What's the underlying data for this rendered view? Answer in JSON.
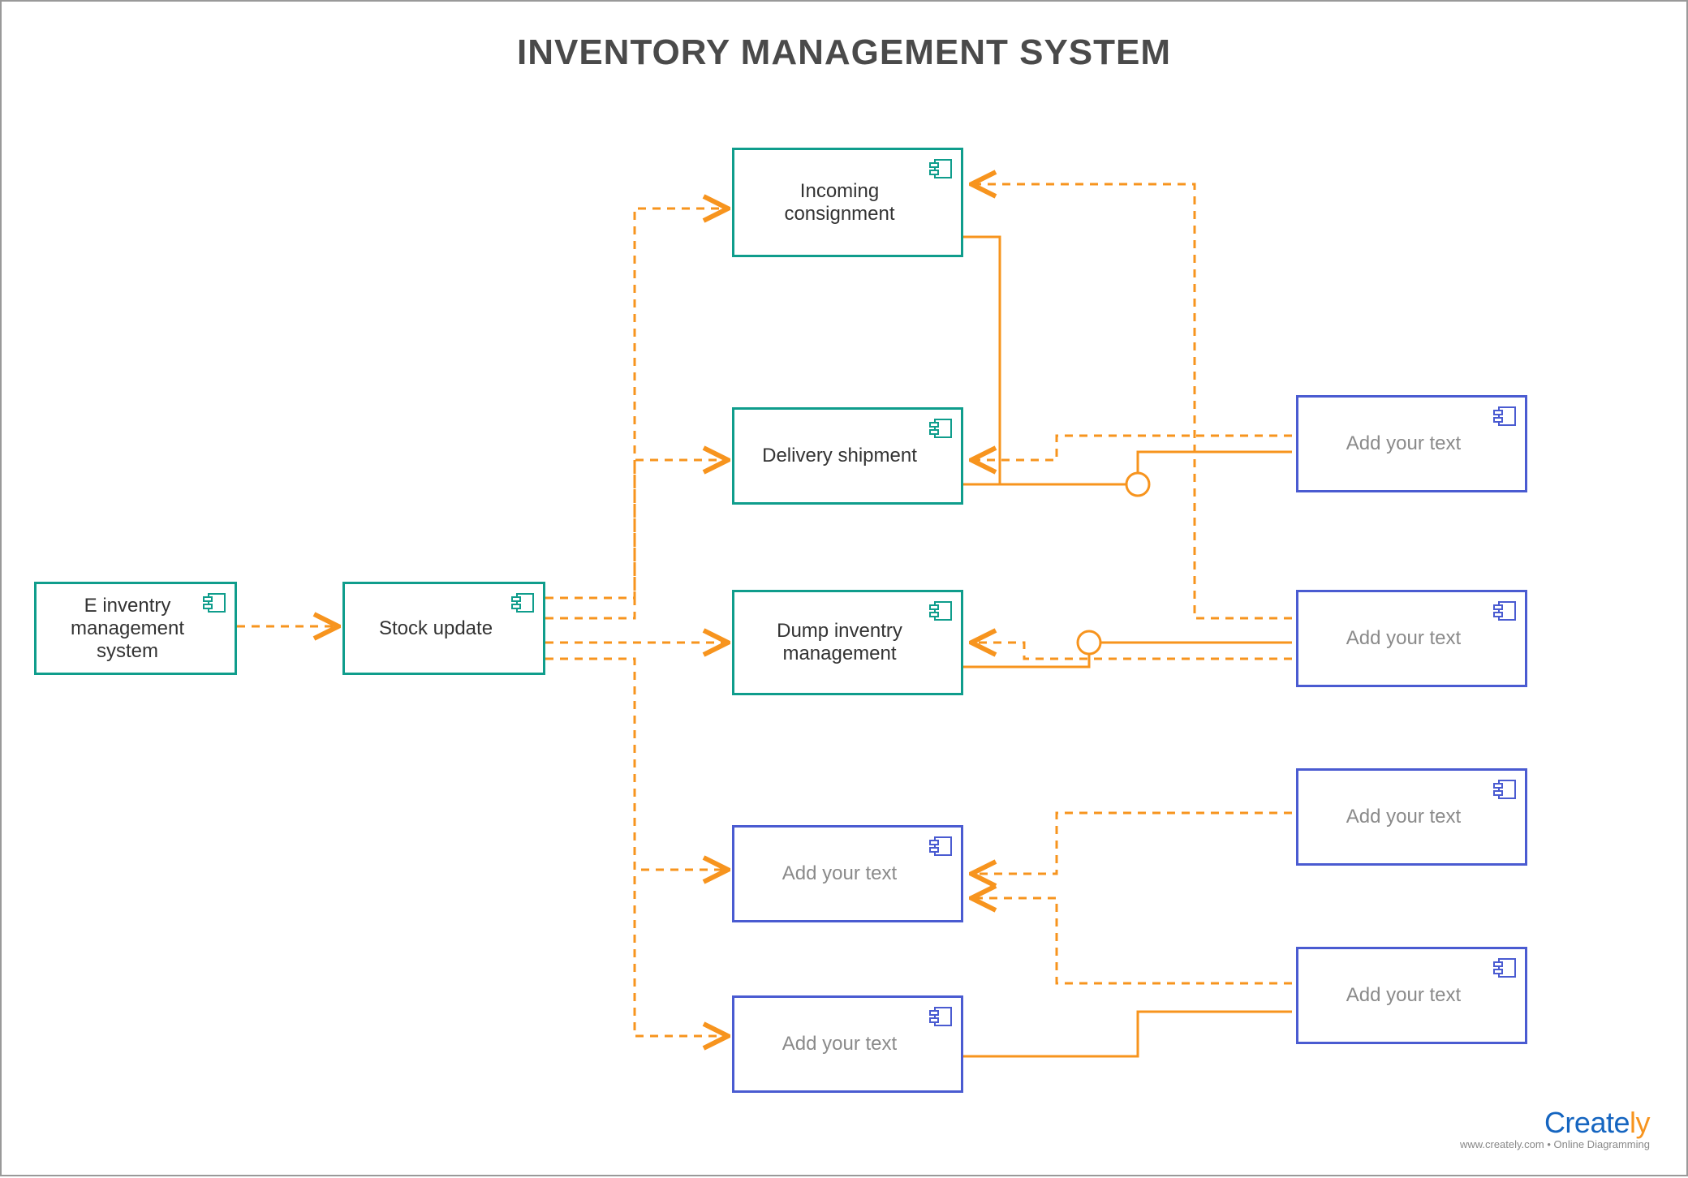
{
  "title": "INVENTORY MANAGEMENT SYSTEM",
  "colors": {
    "teal": "#0f9d8c",
    "blue": "#4a5bd1",
    "orange": "#f7941e"
  },
  "nodes": {
    "root": {
      "label": "E inventry management system",
      "placeholder": false
    },
    "stock": {
      "label": "Stock update",
      "placeholder": false
    },
    "incoming": {
      "label": "Incoming consignment",
      "placeholder": false
    },
    "delivery": {
      "label": "Delivery shipment",
      "placeholder": false
    },
    "dump": {
      "label": "Dump inventry management",
      "placeholder": false
    },
    "mid1": {
      "label": "Add your text",
      "placeholder": true
    },
    "mid2": {
      "label": "Add your text",
      "placeholder": true
    },
    "right1": {
      "label": "Add your text",
      "placeholder": true
    },
    "right2": {
      "label": "Add your text",
      "placeholder": true
    },
    "right3": {
      "label": "Add your text",
      "placeholder": true
    },
    "right4": {
      "label": "Add your text",
      "placeholder": true
    }
  },
  "edges": [
    {
      "from": "root",
      "to": "stock",
      "style": "dashed",
      "arrow": "open"
    },
    {
      "from": "stock",
      "to": "incoming",
      "style": "dashed",
      "arrow": "open"
    },
    {
      "from": "stock",
      "to": "delivery",
      "style": "dashed",
      "arrow": "open"
    },
    {
      "from": "stock",
      "to": "dump",
      "style": "dashed",
      "arrow": "open"
    },
    {
      "from": "stock",
      "to": "mid1",
      "style": "dashed",
      "arrow": "open"
    },
    {
      "from": "stock",
      "to": "mid2",
      "style": "dashed",
      "arrow": "open"
    },
    {
      "from": "incoming",
      "to": "delivery",
      "style": "solid",
      "arrow": "none"
    },
    {
      "from": "delivery",
      "to": "right1",
      "style": "solid",
      "arrow": "socket"
    },
    {
      "from": "dump",
      "to": "right2",
      "style": "solid",
      "arrow": "socket"
    },
    {
      "from": "right1",
      "to": "delivery",
      "style": "dashed",
      "arrow": "open"
    },
    {
      "from": "right2",
      "to": "dump",
      "style": "dashed",
      "arrow": "open"
    },
    {
      "from": "right2",
      "to": "incoming",
      "style": "dashed",
      "arrow": "open"
    },
    {
      "from": "right3",
      "to": "mid1",
      "style": "dashed",
      "arrow": "open"
    },
    {
      "from": "right4",
      "to": "mid1",
      "style": "dashed",
      "arrow": "open"
    },
    {
      "from": "mid2",
      "to": "right4",
      "style": "solid",
      "arrow": "none"
    }
  ],
  "footer": {
    "brand_c": "Create",
    "brand_ly": "ly",
    "sub": "www.creately.com • Online Diagramming"
  }
}
